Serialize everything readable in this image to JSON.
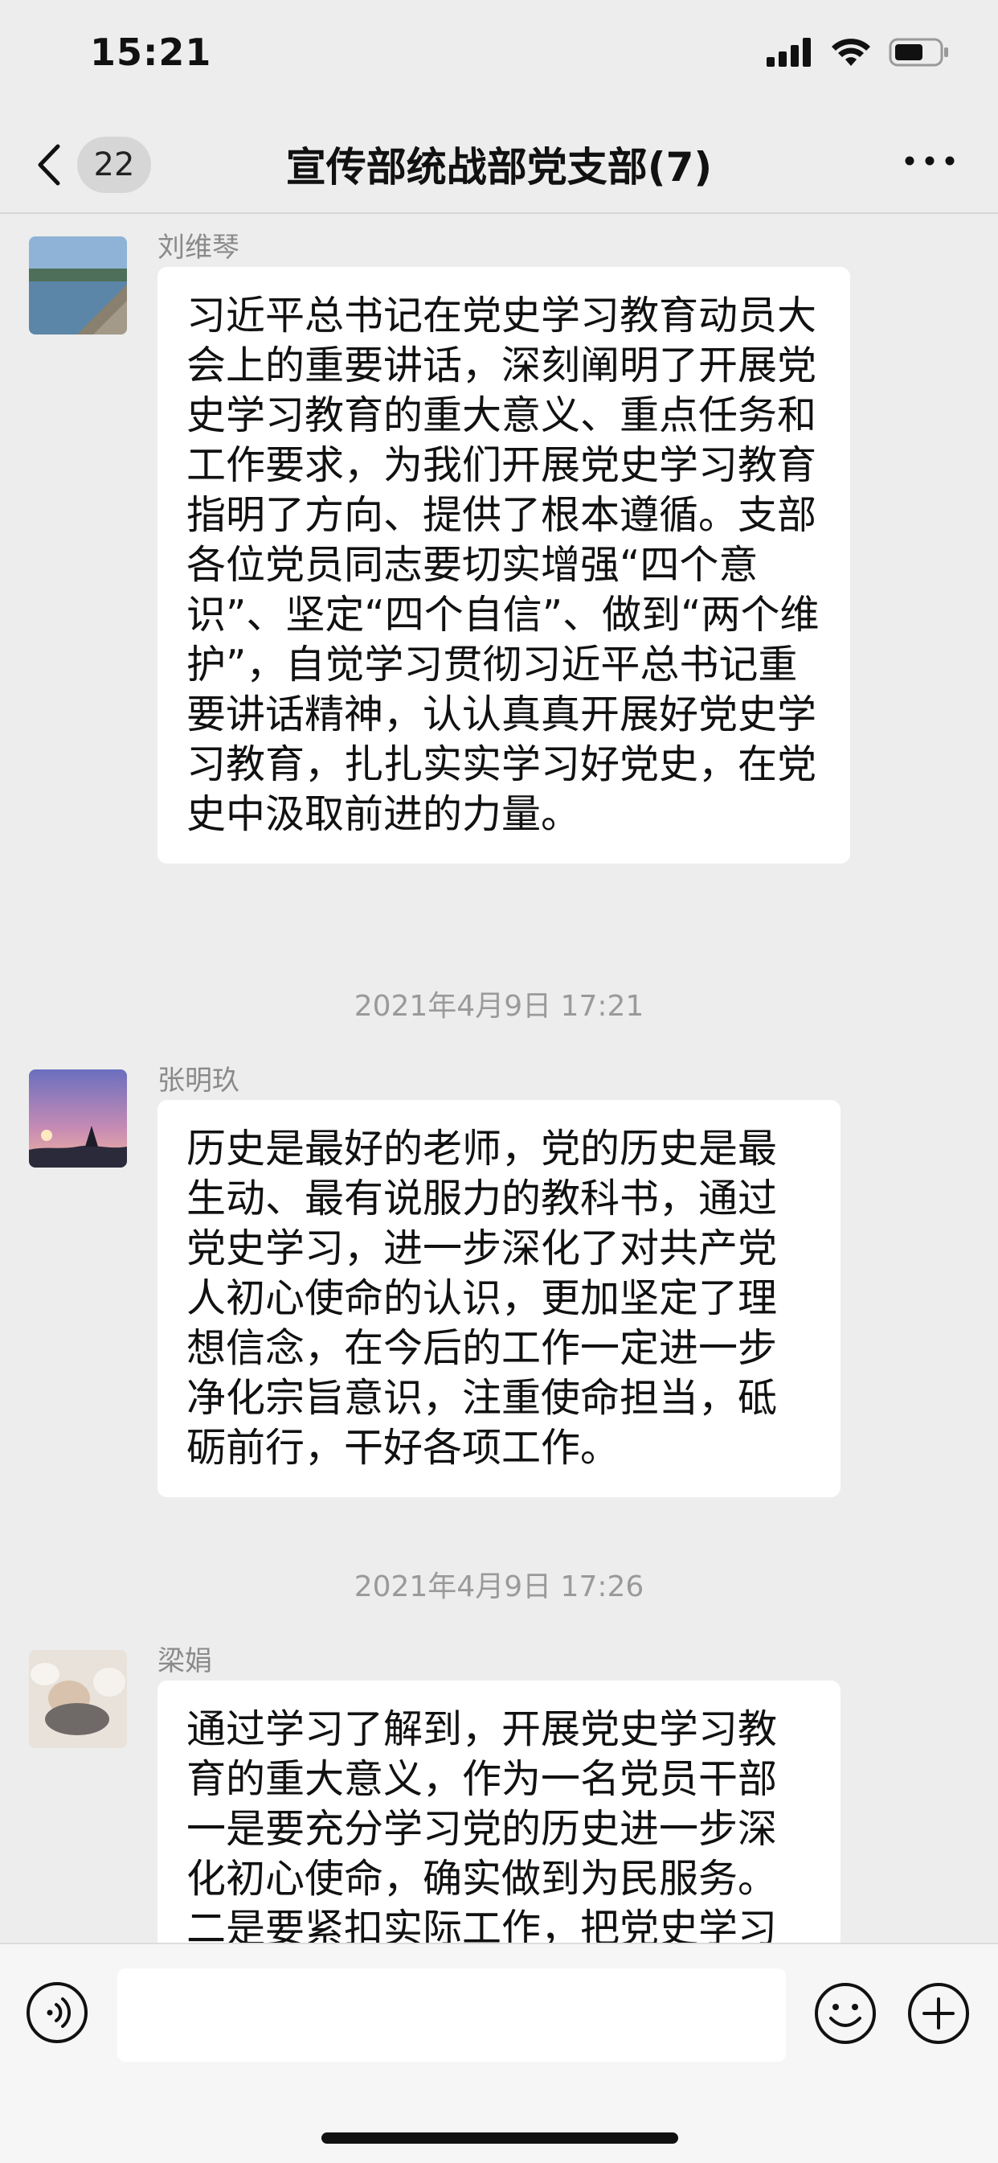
{
  "status": {
    "time": "15:21"
  },
  "nav": {
    "back_count": "22",
    "title": "宣传部统战部党支部(7)"
  },
  "messages": [
    {
      "sender": "刘维琴",
      "avatar": "lake-shore-avatar",
      "text": "习近平总书记在党史学习教育动员大会上的重要讲话，深刻阐明了开展党史学习教育的重大意义、重点任务和工作要求，为我们开展党史学习教育指明了方向、提供了根本遵循。支部各位党员同志要切实增强“四个意识”、坚定“四个自信”、做到“两个维护”，自觉学习贯彻习近平总书记重要讲话精神，认认真真开展好党史学习教育，扎扎实实学习好党史，在党史中汲取前进的力量。"
    },
    {
      "sender": "张明玖",
      "avatar": "sunset-avatar",
      "text": "历史是最好的老师，党的历史是最生动、最有说服力的教科书，通过党史学习，进一步深化了对共产党人初心使命的认识，更加坚定了理想信念，在今后的工作一定进一步净化宗旨意识，注重使命担当，砥砺前行，干好各项工作。"
    },
    {
      "sender": "梁娟",
      "avatar": "baby-photo-avatar",
      "text": "通过学习了解到，开展党史学习教育的重大意义，作为一名党员干部一是要充分学习党的历史进一步深化初心使命，确实做到为民服务。二是要紧扣实际工作，把党史学习"
    }
  ],
  "timestamps": [
    "2021年4月9日 17:21",
    "2021年4月9日 17:26"
  ],
  "input": {
    "value": "",
    "placeholder": ""
  },
  "colors": {
    "background": "#ededed",
    "bubble": "#ffffff",
    "input_bar": "#f6f6f6"
  }
}
